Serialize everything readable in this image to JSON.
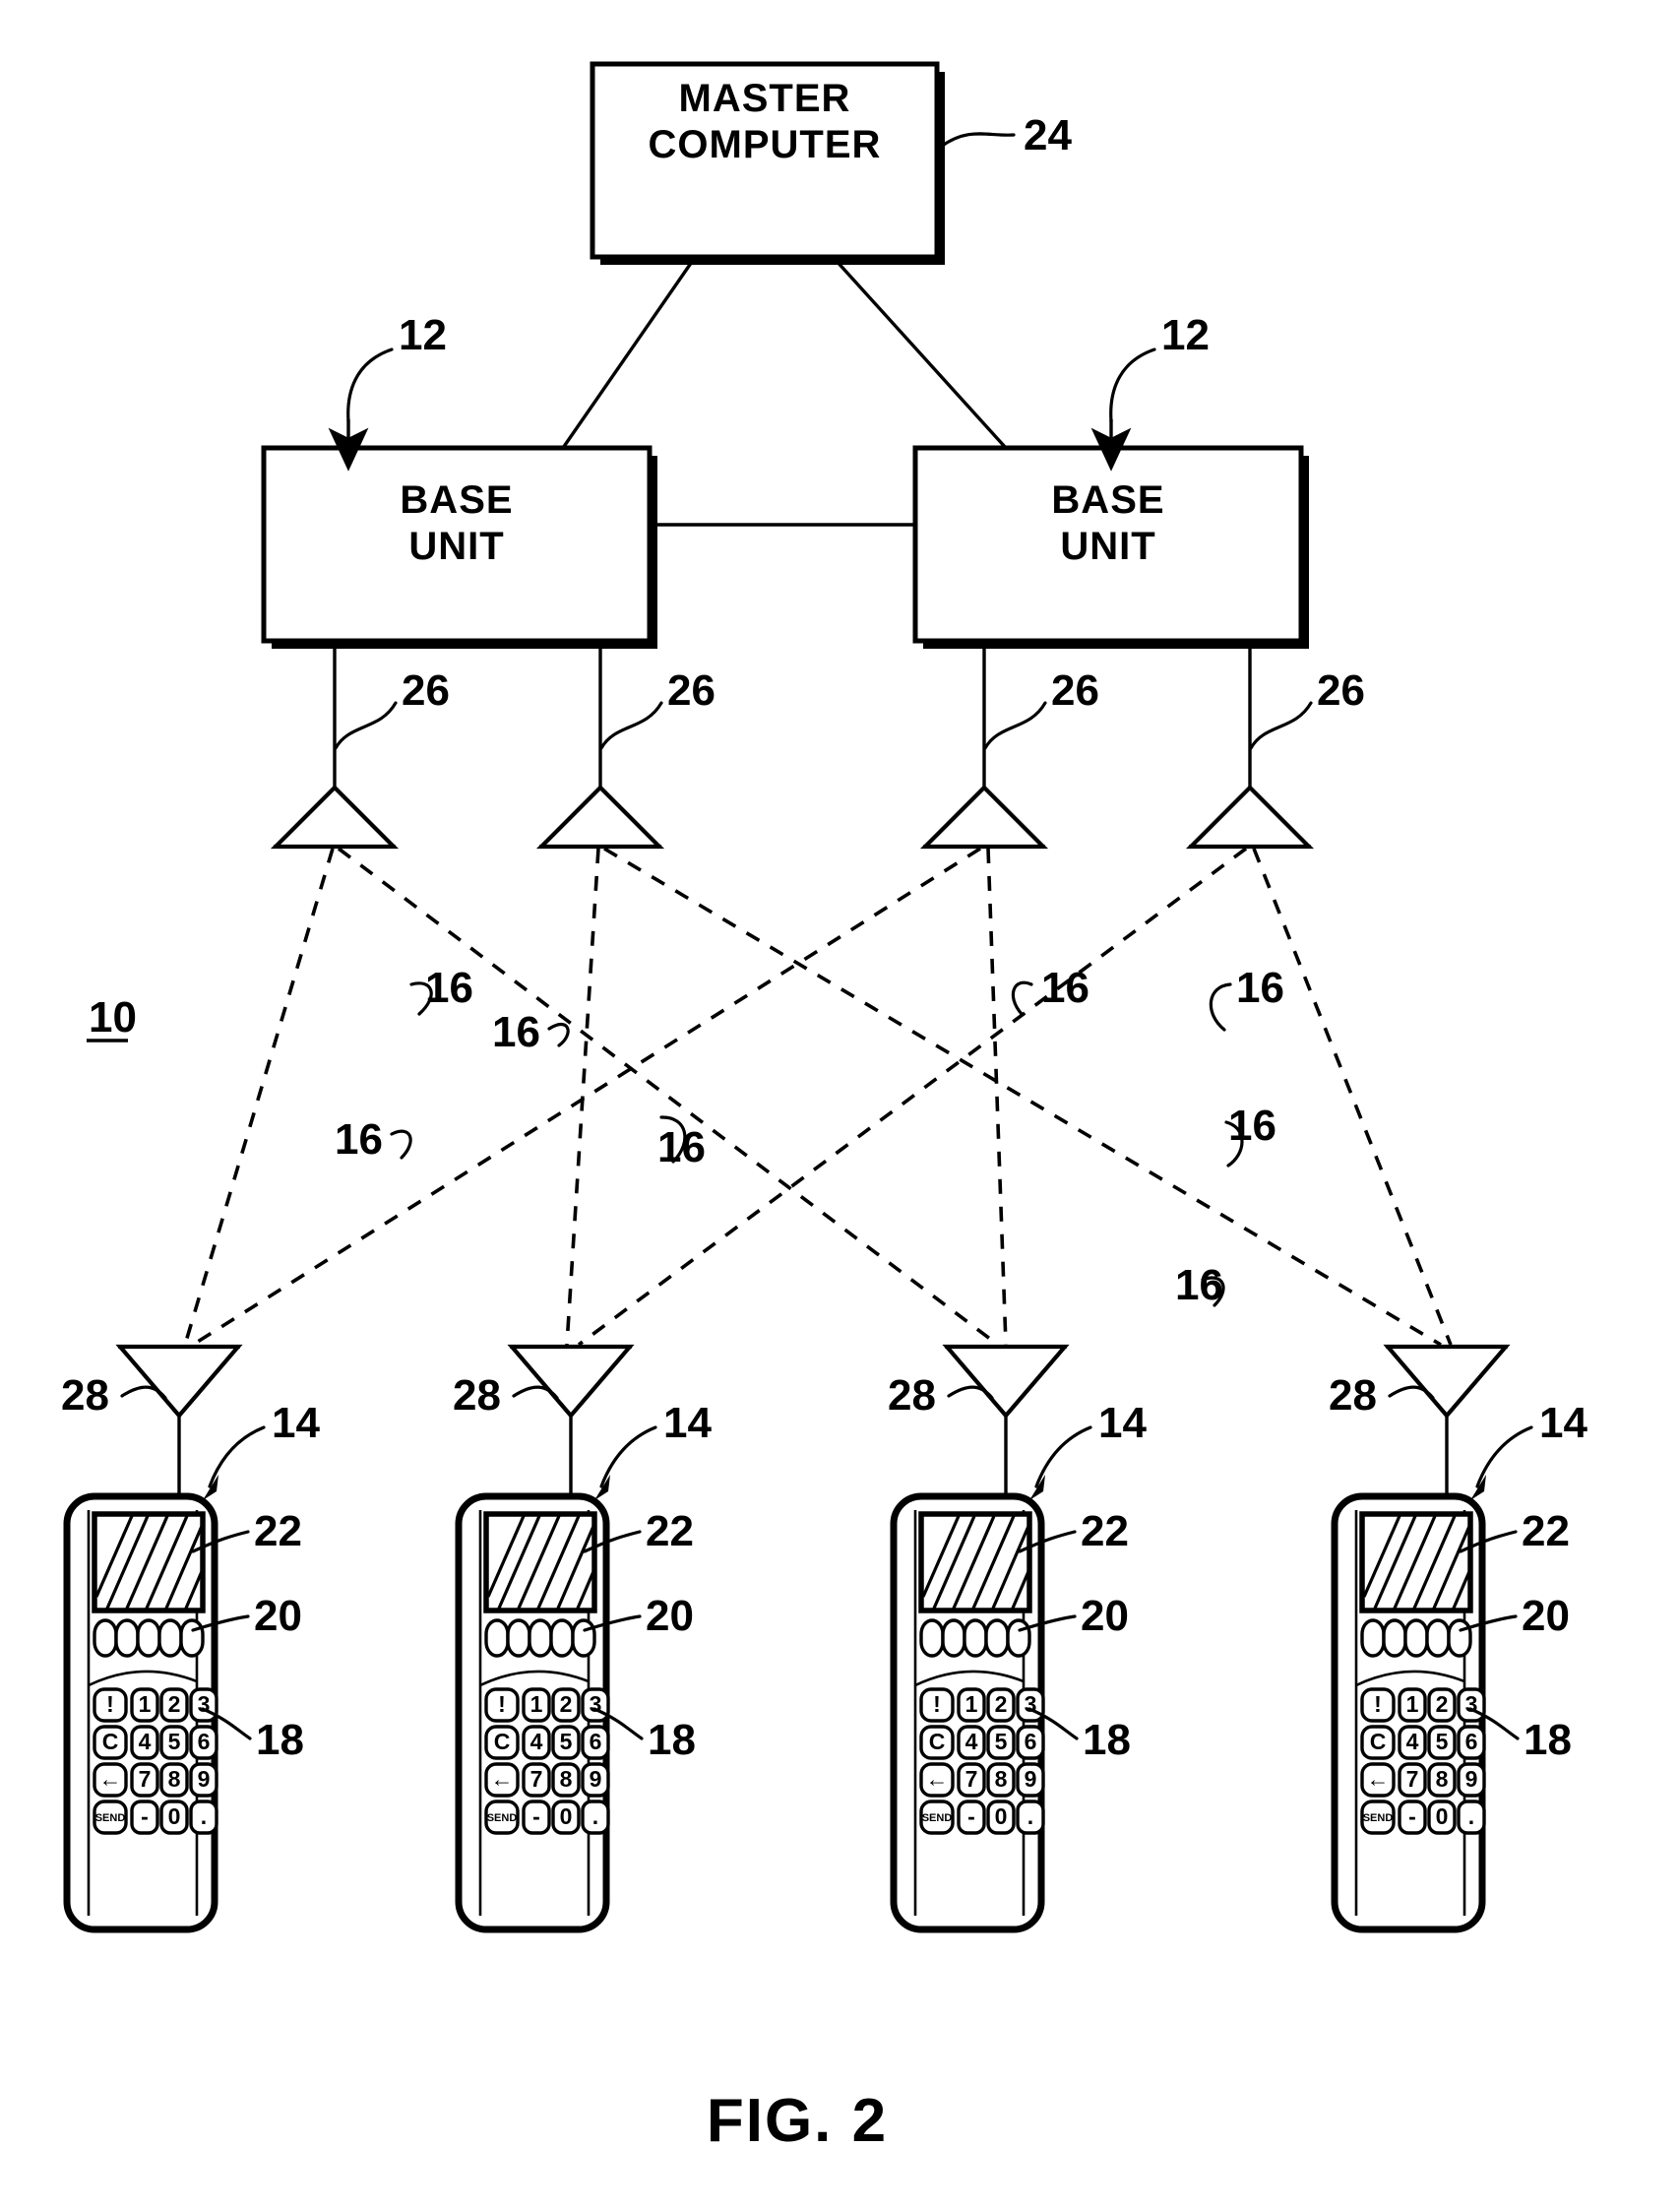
{
  "figure": {
    "caption": "FIG. 2",
    "system_ref": "10"
  },
  "nodes": {
    "master_computer": {
      "ref": "24",
      "line1": "MASTER",
      "line2": "COMPUTER"
    },
    "base_unit_left": {
      "ref": "12",
      "line1": "BASE",
      "line2": "UNIT"
    },
    "base_unit_right": {
      "ref": "12",
      "line1": "BASE",
      "line2": "UNIT"
    }
  },
  "reference_numerals": {
    "system": "10",
    "base_unit": "12",
    "handset": "14",
    "wireless_link": "16",
    "keypad": "18",
    "soft_keys": "20",
    "display": "22",
    "master_computer": "24",
    "base_antenna": "26",
    "handset_antenna": "28"
  },
  "base_antennas": [
    {
      "ref": "26"
    },
    {
      "ref": "26"
    },
    {
      "ref": "26"
    },
    {
      "ref": "26"
    }
  ],
  "handset_antennas": [
    {
      "ref": "28"
    },
    {
      "ref": "28"
    },
    {
      "ref": "28"
    },
    {
      "ref": "28"
    }
  ],
  "wireless_links": [
    {
      "ref": "16"
    },
    {
      "ref": "16"
    },
    {
      "ref": "16"
    },
    {
      "ref": "16"
    },
    {
      "ref": "16"
    },
    {
      "ref": "16"
    },
    {
      "ref": "16"
    },
    {
      "ref": "16"
    }
  ],
  "handsets": [
    {
      "ref": "14",
      "display_ref": "22",
      "soft_keys_ref": "20",
      "keypad_ref": "18",
      "soft_keys": [
        "",
        "",
        "",
        "",
        ""
      ],
      "keypad_rows": [
        [
          "!",
          "1",
          "2",
          "3"
        ],
        [
          "C",
          "4",
          "5",
          "6"
        ],
        [
          "←",
          "7",
          "8",
          "9"
        ],
        [
          "SEND",
          "-",
          "0",
          "."
        ]
      ]
    },
    {
      "ref": "14",
      "display_ref": "22",
      "soft_keys_ref": "20",
      "keypad_ref": "18",
      "soft_keys": [
        "",
        "",
        "",
        "",
        ""
      ],
      "keypad_rows": [
        [
          "!",
          "1",
          "2",
          "3"
        ],
        [
          "C",
          "4",
          "5",
          "6"
        ],
        [
          "←",
          "7",
          "8",
          "9"
        ],
        [
          "SEND",
          "-",
          "0",
          "."
        ]
      ]
    },
    {
      "ref": "14",
      "display_ref": "22",
      "soft_keys_ref": "20",
      "keypad_ref": "18",
      "soft_keys": [
        "",
        "",
        "",
        "",
        ""
      ],
      "keypad_rows": [
        [
          "!",
          "1",
          "2",
          "3"
        ],
        [
          "C",
          "4",
          "5",
          "6"
        ],
        [
          "←",
          "7",
          "8",
          "9"
        ],
        [
          "SEND",
          "-",
          "0",
          "."
        ]
      ]
    },
    {
      "ref": "14",
      "display_ref": "22",
      "soft_keys_ref": "20",
      "keypad_ref": "18",
      "soft_keys": [
        "",
        "",
        "",
        "",
        ""
      ],
      "keypad_rows": [
        [
          "!",
          "1",
          "2",
          "3"
        ],
        [
          "C",
          "4",
          "5",
          "6"
        ],
        [
          "←",
          "7",
          "8",
          "9"
        ],
        [
          "SEND",
          "-",
          "0",
          "."
        ]
      ]
    }
  ],
  "colors": {
    "ink": "#000000",
    "paper": "#ffffff"
  }
}
